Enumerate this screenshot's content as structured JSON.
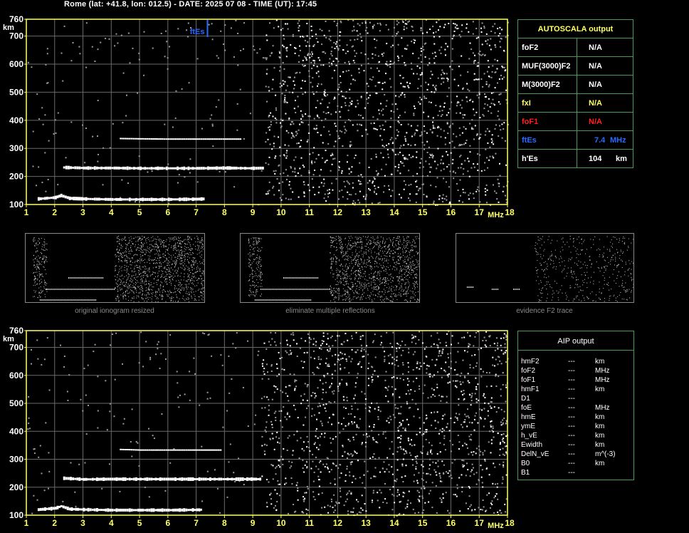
{
  "header": "Rome (lat: +41.8, lon: 012.5) - DATE: 2025 07 08 - TIME (UT): 17:45",
  "chart_data": [
    {
      "type": "scatter",
      "name": "main ionogram",
      "xlabel": "MHz",
      "ylabel": "km",
      "xlim": [
        1,
        18
      ],
      "ylim": [
        100,
        760
      ],
      "xticks": [
        "1",
        "2",
        "3",
        "4",
        "5",
        "6",
        "7",
        "8",
        "9",
        "10",
        "11",
        "12",
        "13",
        "14",
        "15",
        "16",
        "17",
        "18"
      ],
      "yticks": [
        "760",
        "700",
        "600",
        "500",
        "400",
        "300",
        "200",
        "100"
      ],
      "grid": true,
      "traces": [
        {
          "name": "E/Es trace",
          "x": [
            1.4,
            2.0,
            2.2,
            2.5,
            3.0,
            4.0,
            5.0,
            6.0,
            7.0,
            7.3
          ],
          "y": [
            120,
            125,
            132,
            122,
            120,
            118,
            118,
            118,
            119,
            120
          ]
        },
        {
          "name": "F trace",
          "x": [
            2.3,
            3.0,
            4.0,
            5.0,
            6.0,
            7.0,
            8.0,
            9.0,
            9.4
          ],
          "y": [
            232,
            230,
            230,
            229,
            229,
            229,
            230,
            229,
            230
          ]
        },
        {
          "name": "second hop",
          "x": [
            4.3,
            5.0,
            6.0,
            7.0,
            8.0,
            8.6
          ],
          "y": [
            335,
            334,
            333,
            333,
            333,
            333
          ]
        }
      ],
      "markers": [
        {
          "label": "ftEs",
          "x": 7.4,
          "color": "#2a6bff"
        }
      ],
      "noise_region_start_mhz": 9.4
    },
    {
      "type": "scatter",
      "name": "AIP ionogram",
      "xlabel": "MHz",
      "ylabel": "km",
      "xlim": [
        1,
        18
      ],
      "ylim": [
        100,
        760
      ],
      "xticks": [
        "1",
        "2",
        "3",
        "4",
        "5",
        "6",
        "7",
        "8",
        "9",
        "10",
        "11",
        "12",
        "13",
        "14",
        "15",
        "16",
        "17",
        "18"
      ],
      "yticks": [
        "760",
        "700",
        "600",
        "500",
        "400",
        "300",
        "200",
        "100"
      ],
      "grid": true,
      "traces": [
        {
          "name": "E/Es trace",
          "x": [
            1.4,
            2.0,
            2.2,
            2.5,
            3.0,
            4.0,
            5.0,
            6.0,
            7.0,
            7.2
          ],
          "y": [
            120,
            125,
            132,
            122,
            120,
            118,
            118,
            118,
            119,
            120
          ]
        },
        {
          "name": "F trace",
          "x": [
            2.3,
            3.0,
            4.0,
            5.0,
            6.0,
            7.0,
            8.0,
            9.0,
            9.3
          ],
          "y": [
            232,
            228,
            229,
            229,
            229,
            229,
            229,
            229,
            229
          ]
        },
        {
          "name": "second hop",
          "x": [
            4.3,
            5.0,
            6.0,
            7.0,
            7.9
          ],
          "y": [
            335,
            333,
            333,
            333,
            333
          ]
        }
      ],
      "noise_region_start_mhz": 9.3
    }
  ],
  "thumbnails": [
    {
      "caption": "original ionogram resized"
    },
    {
      "caption": "eliminate multiple reflections"
    },
    {
      "caption": "evidence F2 trace"
    }
  ],
  "autoscala": {
    "title": "AUTOSCALA output",
    "rows": [
      {
        "label": "foF2",
        "value": "N/A",
        "unit": "",
        "color": "#ffffff"
      },
      {
        "label": "MUF(3000)F2",
        "value": "N/A",
        "unit": "",
        "color": "#ffffff"
      },
      {
        "label": "M(3000)F2",
        "value": "N/A",
        "unit": "",
        "color": "#ffffff"
      },
      {
        "label": "fxI",
        "value": "N/A",
        "unit": "",
        "color": "#ffff66"
      },
      {
        "label": "foF1",
        "value": "N/A",
        "unit": "",
        "color": "#ff2020"
      },
      {
        "label": "ftEs",
        "value": "7.4",
        "unit": "MHz",
        "color": "#2a6bff"
      },
      {
        "label": "h'Es",
        "value": "104",
        "unit": "km",
        "color": "#ffffff"
      }
    ]
  },
  "aip": {
    "title": "AIP output",
    "rows": [
      {
        "label": "hmF2",
        "value": "---",
        "unit": "km"
      },
      {
        "label": "foF2",
        "value": "---",
        "unit": "MHz"
      },
      {
        "label": "foF1",
        "value": "---",
        "unit": "MHz"
      },
      {
        "label": "hmF1",
        "value": "---",
        "unit": "km"
      },
      {
        "label": "D1",
        "value": "---",
        "unit": ""
      },
      {
        "label": "foE",
        "value": "---",
        "unit": "MHz"
      },
      {
        "label": "hmE",
        "value": "---",
        "unit": "km"
      },
      {
        "label": "ymE",
        "value": "---",
        "unit": "km"
      },
      {
        "label": "h_vE",
        "value": "---",
        "unit": "km"
      },
      {
        "label": "Ewidth",
        "value": "---",
        "unit": "km"
      },
      {
        "label": "DelN_vE",
        "value": "---",
        "unit": "m^(-3)"
      },
      {
        "label": "B0",
        "value": "---",
        "unit": "km"
      },
      {
        "label": "B1",
        "value": "---",
        "unit": ""
      }
    ]
  },
  "colors": {
    "axis": "#ffff66",
    "grid": "#6a6a6a",
    "border": "#4c9a5a",
    "trace": "#ffffff",
    "ftEs": "#2a6bff"
  }
}
